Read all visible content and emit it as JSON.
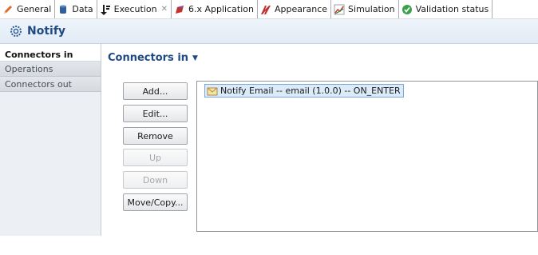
{
  "tabs": [
    {
      "label": "General",
      "icon": "pencil-icon",
      "active": false
    },
    {
      "label": "Data",
      "icon": "database-icon",
      "active": false
    },
    {
      "label": "Execution",
      "icon": "execution-icon",
      "active": true
    },
    {
      "label": "6.x Application",
      "icon": "application-icon",
      "active": false
    },
    {
      "label": "Appearance",
      "icon": "appearance-icon",
      "active": false
    },
    {
      "label": "Simulation",
      "icon": "simulation-icon",
      "active": false
    },
    {
      "label": "Validation status",
      "icon": "check-circle-icon",
      "active": false
    }
  ],
  "header": {
    "title": "Notify",
    "icon": "gear-icon"
  },
  "side_tabs": [
    {
      "label": "Connectors in",
      "active": true
    },
    {
      "label": "Operations",
      "active": false
    },
    {
      "label": "Connectors out",
      "active": false
    }
  ],
  "section": {
    "title": "Connectors in"
  },
  "buttons": {
    "add": "Add...",
    "edit": "Edit...",
    "remove": "Remove",
    "up": "Up",
    "down": "Down",
    "move_copy": "Move/Copy..."
  },
  "connectors": [
    {
      "label": "Notify Email -- email (1.0.0) -- ON_ENTER",
      "icon": "envelope-icon",
      "selected": true
    }
  ],
  "colors": {
    "accent": "#1f4a82",
    "selection": "#dcebfa"
  }
}
